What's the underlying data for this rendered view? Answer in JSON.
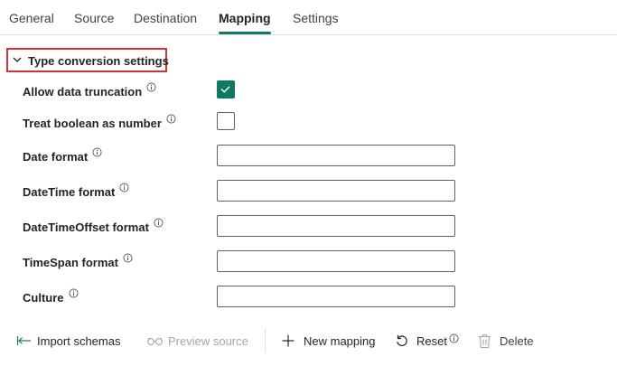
{
  "tabs": [
    {
      "label": "General"
    },
    {
      "label": "Source"
    },
    {
      "label": "Destination"
    },
    {
      "label": "Mapping"
    },
    {
      "label": "Settings"
    }
  ],
  "active_tab": "Mapping",
  "section": {
    "title": "Type conversion settings",
    "expanded": true
  },
  "fields": {
    "allow_truncation": {
      "label": "Allow data truncation",
      "checked": true
    },
    "treat_boolean": {
      "label": "Treat boolean as number",
      "checked": false
    },
    "date_format": {
      "label": "Date format",
      "value": ""
    },
    "datetime_format": {
      "label": "DateTime format",
      "value": ""
    },
    "datetimeoffset_format": {
      "label": "DateTimeOffset format",
      "value": ""
    },
    "timespan_format": {
      "label": "TimeSpan format",
      "value": ""
    },
    "culture": {
      "label": "Culture",
      "value": ""
    }
  },
  "toolbar": {
    "import_schemas": "Import schemas",
    "preview_source": "Preview source",
    "new_mapping": "New mapping",
    "reset": "Reset",
    "delete": "Delete"
  },
  "colors": {
    "accent": "#117865",
    "highlight_border": "#d13438"
  }
}
